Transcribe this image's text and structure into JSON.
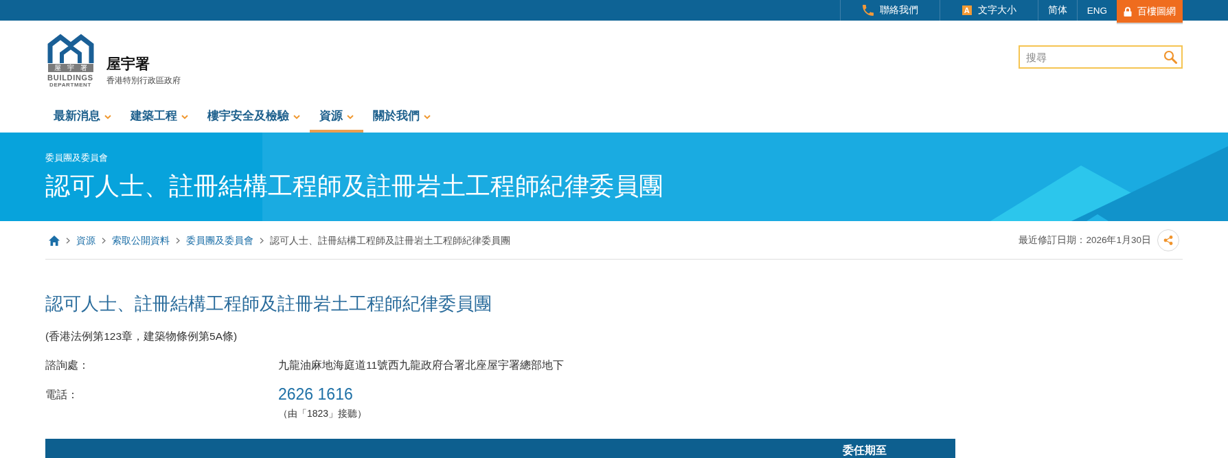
{
  "top_bar": {
    "items": [
      {
        "kind": "phone",
        "label": "聯絡我們"
      },
      {
        "kind": "text_size",
        "icon_letter": "A",
        "label": "文字大小"
      },
      {
        "kind": "plain",
        "label": "简体"
      },
      {
        "kind": "plain",
        "label": "ENG"
      },
      {
        "kind": "locked",
        "label": "百樓圖網"
      }
    ]
  },
  "header": {
    "logo": {
      "band_text": "屋宇署",
      "wordmark": "BUILDINGS",
      "sub_wordmark": "DEPARTMENT"
    },
    "title": "屋宇署",
    "subtitle": "香港特別行政區政府",
    "search": {
      "placeholder": "搜尋"
    }
  },
  "nav": {
    "items": [
      {
        "label": "最新消息",
        "selected": false
      },
      {
        "label": "建築工程",
        "selected": false
      },
      {
        "label": "樓宇安全及檢驗",
        "selected": false
      },
      {
        "label": "資源",
        "selected": true
      },
      {
        "label": "關於我們",
        "selected": false
      }
    ]
  },
  "banner": {
    "category": "委員團及委員會",
    "title": "認可人士、註冊結構工程師及註冊岩土工程師紀律委員團"
  },
  "breadcrumb": {
    "items": [
      {
        "kind": "link",
        "label": "資源"
      },
      {
        "kind": "link",
        "label": "索取公開資料"
      },
      {
        "kind": "link",
        "label": "委員團及委員會"
      },
      {
        "kind": "current",
        "label": "認可人士、註冊結構工程師及註冊岩土工程師紀律委員團"
      }
    ],
    "last_revised": "最近修訂日期：2026年1月30日"
  },
  "content": {
    "heading": "認可人士、註冊結構工程師及註冊岩土工程師紀律委員團",
    "law_reference": "(香港法例第123章，建築物條例第5A條)",
    "details": [
      {
        "kind": "address",
        "label": "諮詢處：",
        "value": "九龍油麻地海庭道11號西九龍政府合署北座屋宇署總部地下"
      },
      {
        "kind": "phone",
        "label": "電話：",
        "value": "2626 1616",
        "note": "（由「1823」接聽）"
      }
    ],
    "table": {
      "columns": [
        {
          "label": "委任期至"
        }
      ]
    }
  }
}
